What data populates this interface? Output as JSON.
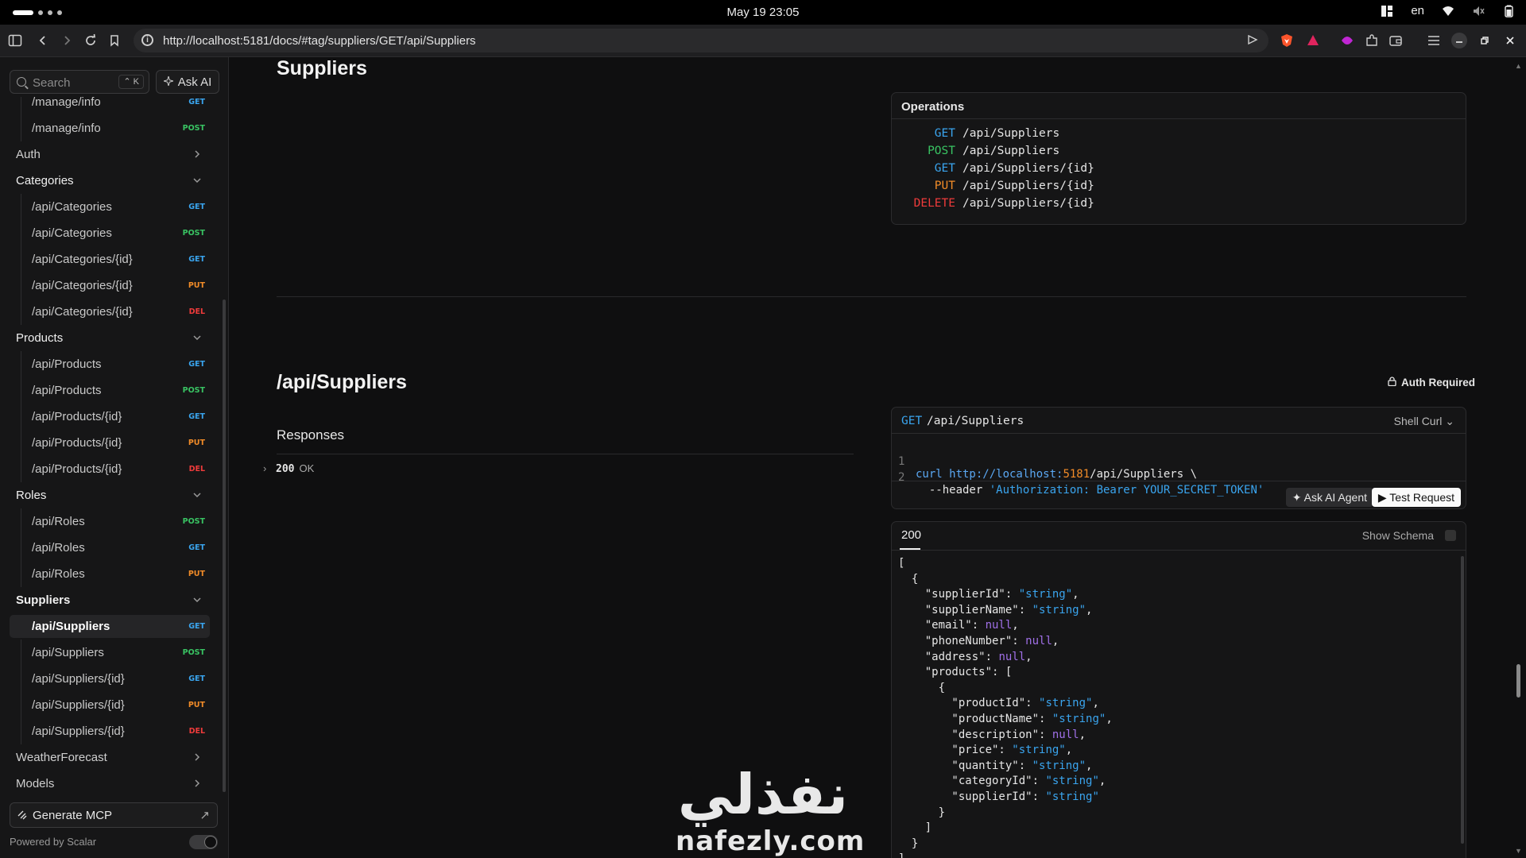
{
  "os": {
    "clock": "May 19  23:05",
    "lang": "en"
  },
  "browser": {
    "url": "http://localhost:5181/docs/#tag/suppliers/GET/api/Suppliers"
  },
  "sidebar": {
    "search_placeholder": "Search",
    "search_kbd": "⌃ K",
    "ask_ai": "Ask AI",
    "rows": [
      {
        "kind": "item",
        "label": "/manage/info",
        "method": "GET",
        "cls": "m-get"
      },
      {
        "kind": "item",
        "label": "/manage/info",
        "method": "POST",
        "cls": "m-post"
      },
      {
        "kind": "group",
        "label": "Auth",
        "open": false
      },
      {
        "kind": "group",
        "label": "Categories",
        "open": true
      },
      {
        "kind": "item",
        "label": "/api/Categories",
        "method": "GET",
        "cls": "m-get"
      },
      {
        "kind": "item",
        "label": "/api/Categories",
        "method": "POST",
        "cls": "m-post"
      },
      {
        "kind": "item",
        "label": "/api/Categories/{id}",
        "method": "GET",
        "cls": "m-get"
      },
      {
        "kind": "item",
        "label": "/api/Categories/{id}",
        "method": "PUT",
        "cls": "m-put"
      },
      {
        "kind": "item",
        "label": "/api/Categories/{id}",
        "method": "DEL",
        "cls": "m-del"
      },
      {
        "kind": "group",
        "label": "Products",
        "open": true
      },
      {
        "kind": "item",
        "label": "/api/Products",
        "method": "GET",
        "cls": "m-get"
      },
      {
        "kind": "item",
        "label": "/api/Products",
        "method": "POST",
        "cls": "m-post"
      },
      {
        "kind": "item",
        "label": "/api/Products/{id}",
        "method": "GET",
        "cls": "m-get"
      },
      {
        "kind": "item",
        "label": "/api/Products/{id}",
        "method": "PUT",
        "cls": "m-put"
      },
      {
        "kind": "item",
        "label": "/api/Products/{id}",
        "method": "DEL",
        "cls": "m-del"
      },
      {
        "kind": "group",
        "label": "Roles",
        "open": true
      },
      {
        "kind": "item",
        "label": "/api/Roles",
        "method": "POST",
        "cls": "m-post"
      },
      {
        "kind": "item",
        "label": "/api/Roles",
        "method": "GET",
        "cls": "m-get"
      },
      {
        "kind": "item",
        "label": "/api/Roles",
        "method": "PUT",
        "cls": "m-put"
      },
      {
        "kind": "group",
        "label": "Suppliers",
        "open": true,
        "bold": true
      },
      {
        "kind": "item",
        "label": "/api/Suppliers",
        "method": "GET",
        "cls": "m-get",
        "active": true
      },
      {
        "kind": "item",
        "label": "/api/Suppliers",
        "method": "POST",
        "cls": "m-post"
      },
      {
        "kind": "item",
        "label": "/api/Suppliers/{id}",
        "method": "GET",
        "cls": "m-get"
      },
      {
        "kind": "item",
        "label": "/api/Suppliers/{id}",
        "method": "PUT",
        "cls": "m-put"
      },
      {
        "kind": "item",
        "label": "/api/Suppliers/{id}",
        "method": "DEL",
        "cls": "m-del"
      },
      {
        "kind": "group",
        "label": "WeatherForecast",
        "open": false
      },
      {
        "kind": "group",
        "label": "Models",
        "open": false
      }
    ],
    "generate_mcp": "Generate MCP",
    "powered_by": "Powered by Scalar"
  },
  "main": {
    "tag_title": "Suppliers",
    "operations_title": "Operations",
    "operations": [
      {
        "method": "GET",
        "path": "/api/Suppliers",
        "cls": "m-get"
      },
      {
        "method": "POST",
        "path": "/api/Suppliers",
        "cls": "m-post"
      },
      {
        "method": "GET",
        "path": "/api/Suppliers/{id}",
        "cls": "m-get"
      },
      {
        "method": "PUT",
        "path": "/api/Suppliers/{id}",
        "cls": "m-put"
      },
      {
        "method": "DELETE",
        "path": "/api/Suppliers/{id}",
        "cls": "m-del"
      }
    ],
    "endpoint_title": "/api/Suppliers",
    "auth_required": "Auth Required",
    "responses_title": "Responses",
    "response_code": "200",
    "response_text": "OK",
    "request": {
      "method": "GET",
      "path": "/api/Suppliers",
      "client": "Shell Curl",
      "line1_ln": "1",
      "line1_a": "curl http://localhost:",
      "line1_port": "5181",
      "line1_b": "/api/Suppliers \\",
      "line2_ln": "2",
      "line2_a": "  --header ",
      "line2_str": "'Authorization: Bearer YOUR_SECRET_TOKEN'",
      "ask_agent": "Ask AI Agent",
      "test_request": "Test Request"
    },
    "example": {
      "status_tab": "200",
      "show_schema": "Show Schema",
      "lines": [
        [
          [
            "",
            "["
          ]
        ],
        [
          [
            "",
            "  {"
          ]
        ],
        [
          [
            "",
            "    \"supplierId\": "
          ],
          [
            "j-str",
            "\"string\""
          ],
          [
            "",
            ","
          ]
        ],
        [
          [
            "",
            "    \"supplierName\": "
          ],
          [
            "j-str",
            "\"string\""
          ],
          [
            "",
            ","
          ]
        ],
        [
          [
            "",
            "    \"email\": "
          ],
          [
            "j-null",
            "null"
          ],
          [
            "",
            ","
          ]
        ],
        [
          [
            "",
            "    \"phoneNumber\": "
          ],
          [
            "j-null",
            "null"
          ],
          [
            "",
            ","
          ]
        ],
        [
          [
            "",
            "    \"address\": "
          ],
          [
            "j-null",
            "null"
          ],
          [
            "",
            ","
          ]
        ],
        [
          [
            "",
            "    \"products\": ["
          ]
        ],
        [
          [
            "",
            "      {"
          ]
        ],
        [
          [
            "",
            "        \"productId\": "
          ],
          [
            "j-str",
            "\"string\""
          ],
          [
            "",
            ","
          ]
        ],
        [
          [
            "",
            "        \"productName\": "
          ],
          [
            "j-str",
            "\"string\""
          ],
          [
            "",
            ","
          ]
        ],
        [
          [
            "",
            "        \"description\": "
          ],
          [
            "j-null",
            "null"
          ],
          [
            "",
            ","
          ]
        ],
        [
          [
            "",
            "        \"price\": "
          ],
          [
            "j-str",
            "\"string\""
          ],
          [
            "",
            ","
          ]
        ],
        [
          [
            "",
            "        \"quantity\": "
          ],
          [
            "j-str",
            "\"string\""
          ],
          [
            "",
            ","
          ]
        ],
        [
          [
            "",
            "        \"categoryId\": "
          ],
          [
            "j-str",
            "\"string\""
          ],
          [
            "",
            ","
          ]
        ],
        [
          [
            "",
            "        \"supplierId\": "
          ],
          [
            "j-str",
            "\"string\""
          ]
        ],
        [
          [
            "",
            "      }"
          ]
        ],
        [
          [
            "",
            "    ]"
          ]
        ],
        [
          [
            "",
            "  }"
          ]
        ],
        [
          [
            "",
            "]"
          ]
        ]
      ]
    }
  },
  "watermark": {
    "arabic": "نفذلي",
    "latin": "nafezly.com"
  }
}
